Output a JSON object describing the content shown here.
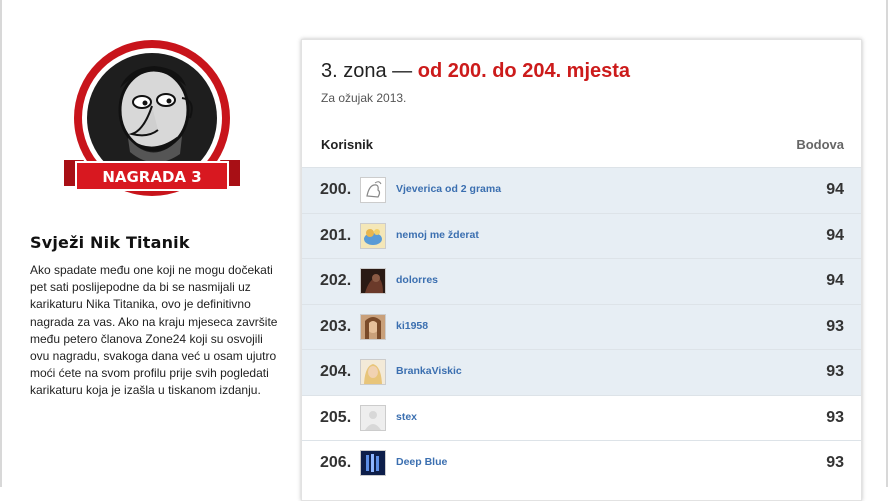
{
  "award": {
    "badge_label": "NAGRADA 3",
    "title": "Svježi Nik Titanik",
    "description": "Ako spadate među one koji ne mogu dočekati pet sati poslijepodne da bi se nasmijali uz karikaturu Nika Titanika, ovo je definitivno nagrada za vas. Ako na kraju mjeseca završite među petero članova Zone24 koji su osvojili ovu nagradu, svakoga dana već u osam ujutro moći ćete na svom profilu prije svih pogledati karikaturu koja je izašla u tiskanom izdanju."
  },
  "zone": {
    "title_prefix": "3. zona —",
    "title_highlight": "od 200. do 204. mjesta",
    "subtitle": "Za ožujak 2013."
  },
  "table": {
    "col_user": "Korisnik",
    "col_points": "Bodova",
    "rows": [
      {
        "rank": "200.",
        "user": "Vjeverica od 2 grama",
        "points": "94",
        "highlight": true,
        "avatar": "squirrel-sketch"
      },
      {
        "rank": "201.",
        "user": "nemoj me žderat",
        "points": "94",
        "highlight": true,
        "avatar": "cartoon"
      },
      {
        "rank": "202.",
        "user": "dolorres",
        "points": "94",
        "highlight": true,
        "avatar": "dark-photo"
      },
      {
        "rank": "203.",
        "user": "ki1958",
        "points": "93",
        "highlight": true,
        "avatar": "portrait"
      },
      {
        "rank": "204.",
        "user": "BrankaViskic",
        "points": "93",
        "highlight": true,
        "avatar": "blonde-portrait"
      },
      {
        "rank": "205.",
        "user": "stex",
        "points": "93",
        "highlight": false,
        "avatar": "default"
      },
      {
        "rank": "206.",
        "user": "Deep Blue",
        "points": "93",
        "highlight": false,
        "avatar": "blue-image"
      }
    ]
  },
  "colors": {
    "accent_red": "#cc1b1b",
    "link_blue": "#3b6fb0",
    "row_highlight": "#e7eef4"
  }
}
